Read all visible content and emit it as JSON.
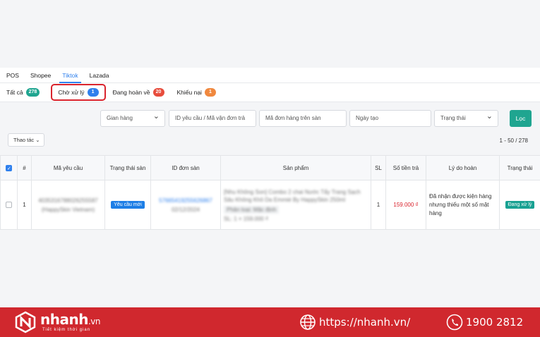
{
  "channel_tabs": [
    "POS",
    "Shopee",
    "Tiktok",
    "Lazada"
  ],
  "status_tabs": [
    {
      "label": "Tất cả",
      "count": "278",
      "color": "#1fa590"
    },
    {
      "label": "Chờ xử lý",
      "count": "1",
      "color": "#2f80ed"
    },
    {
      "label": "Đang hoàn về",
      "count": "20",
      "color": "#e74c3c"
    },
    {
      "label": "Khiếu nại",
      "count": "1",
      "color": "#f0883e"
    }
  ],
  "filters": {
    "shop": "Gian hàng",
    "request_id": "ID yêu cầu / Mã vận đơn trả",
    "order_code": "Mã đơn hàng trên sàn",
    "created_date": "Ngày tạo",
    "status": "Trạng thái",
    "filter_button": "Lọc",
    "actions_button": "Thao tác"
  },
  "pagination": "1 - 50 / 278",
  "table": {
    "headers": {
      "index": "#",
      "request_code": "Mã yêu cầu",
      "platform_status": "Trạng thái sàn",
      "order_id": "ID đơn sàn",
      "product": "Sản phẩm",
      "qty": "SL",
      "refund": "Số tiền trả",
      "reason": "Lý do hoàn",
      "status": "Trạng thái"
    },
    "rows": [
      {
        "index": "1",
        "request_code": "4035316788026255587",
        "request_shop": "(HappySkin Vietnam)",
        "platform_status": "Yêu cầu mới",
        "order_id": "57665419255626867",
        "order_date": "02/12/2024",
        "product_name": "[Nhu Không Son] Combo 2 chai Nước Tẩy Trang Sạch Sâu Không Khô Da Emmié By HappySkin 250ml",
        "product_variant": "Phân loại: Mặc định",
        "product_price": "SL: 1 × 159.000 ₫",
        "qty": "1",
        "refund": "159.000 ₫",
        "reason": "Đã nhận được kiện hàng nhưng thiếu một số mặt hàng",
        "status": "Đang xử lý"
      }
    ]
  },
  "footer": {
    "brand": "nhanh",
    "brand_suffix": ".vn",
    "slogan": "Tiết kiệm thời gian",
    "website": "https://nhanh.vn/",
    "phone": "1900 2812"
  },
  "colors": {
    "accent": "#2f80ed",
    "brand": "#d0282e",
    "success": "#1fa590"
  }
}
